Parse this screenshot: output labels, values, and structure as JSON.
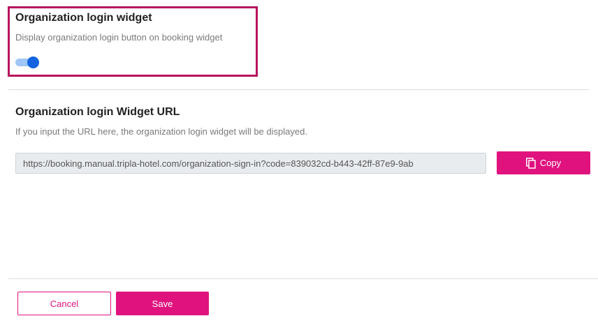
{
  "org_widget": {
    "title": "Organization login widget",
    "description": "Display organization login button on booking widget",
    "toggle_on": true
  },
  "widget_url": {
    "title": "Organization login Widget URL",
    "description": "If you input the URL here, the organization login widget will be displayed.",
    "value": "https://booking.manual.tripla-hotel.com/organization-sign-in?code=839032cd-b443-42ff-87e9-9ab",
    "copy_label": "Copy",
    "copy_icon": "copy-icon"
  },
  "footer": {
    "cancel_label": "Cancel",
    "save_label": "Save"
  },
  "colors": {
    "accent": "#e0137e",
    "highlight_border": "#b8125e",
    "toggle_knob": "#1463e0",
    "toggle_track": "#9fc6f5"
  }
}
